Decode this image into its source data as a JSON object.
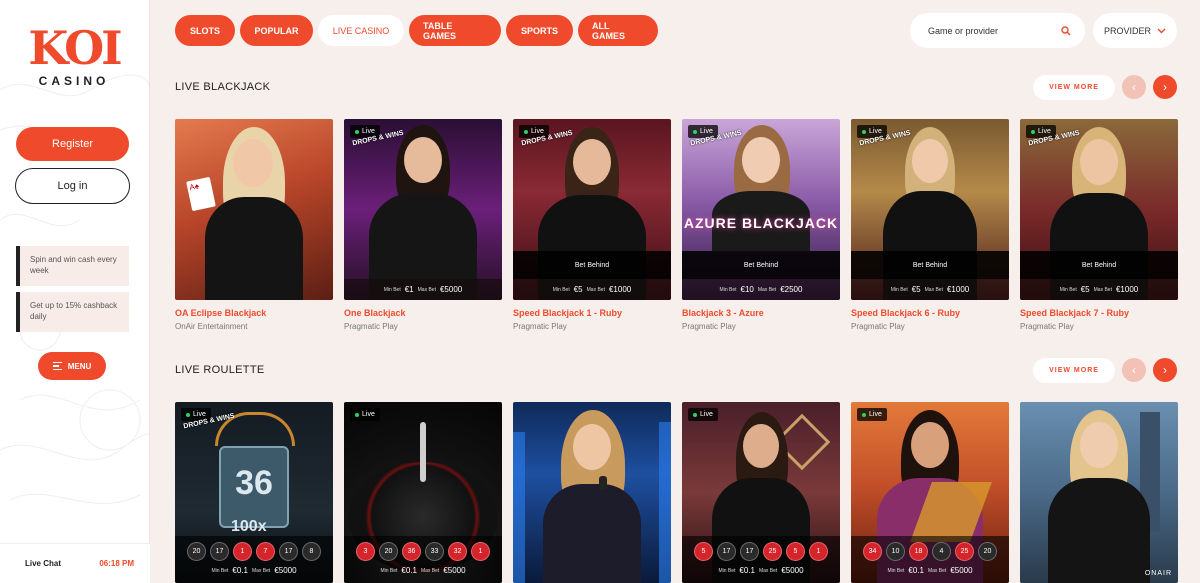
{
  "brand": {
    "logo_mark": "KOI",
    "logo_sub": "CASINO"
  },
  "sidebar": {
    "register": "Register",
    "login": "Log in",
    "promos": [
      "Spin and win cash every week",
      "Get up to 15% cashback daily"
    ],
    "menu": "MENU",
    "live_chat": "Live Chat",
    "time": "06:18 PM"
  },
  "nav": {
    "tabs": [
      "SLOTS",
      "POPULAR",
      "LIVE CASINO",
      "TABLE GAMES",
      "SPORTS",
      "ALL GAMES"
    ],
    "active_index": 2,
    "search_placeholder": "Game or provider",
    "provider": "PROVIDER"
  },
  "sections": [
    {
      "title": "LIVE BLACKJACK",
      "view_more": "VIEW MORE",
      "cards": [
        {
          "title": "OA Eclipse Blackjack",
          "provider": "OnAir Entertainment",
          "live": false,
          "bet_behind": "",
          "min_label": "",
          "min": "",
          "max_label": "",
          "max": ""
        },
        {
          "title": "One Blackjack",
          "provider": "Pragmatic Play",
          "live": true,
          "bet_behind": "",
          "min_label": "Min Bet",
          "min": "€1",
          "max_label": "Max Bet",
          "max": "€5000"
        },
        {
          "title": "Speed Blackjack 1 - Ruby",
          "provider": "Pragmatic Play",
          "live": true,
          "bet_behind": "Bet Behind",
          "min_label": "Min Bet",
          "min": "€5",
          "max_label": "Max Bet",
          "max": "€1000"
        },
        {
          "title": "Blackjack 3 - Azure",
          "provider": "Pragmatic Play",
          "live": true,
          "bet_behind": "Bet Behind",
          "min_label": "Min Bet",
          "min": "€10",
          "max_label": "Max Bet",
          "max": "€2500"
        },
        {
          "title": "Speed Blackjack 6 - Ruby",
          "provider": "Pragmatic Play",
          "live": true,
          "bet_behind": "Bet Behind",
          "min_label": "Min Bet",
          "min": "€5",
          "max_label": "Max Bet",
          "max": "€1000"
        },
        {
          "title": "Speed Blackjack 7 - Ruby",
          "provider": "Pragmatic Play",
          "live": true,
          "bet_behind": "Bet Behind",
          "min_label": "Min Bet",
          "min": "€5",
          "max_label": "Max Bet",
          "max": "€1000"
        }
      ]
    },
    {
      "title": "LIVE ROULETTE",
      "view_more": "VIEW MORE",
      "cards": [
        {
          "live": true,
          "drops": true,
          "numbers": [
            [
              "20",
              "black"
            ],
            [
              "17",
              "black"
            ],
            [
              "1",
              "red"
            ],
            [
              "7",
              "red"
            ],
            [
              "17",
              "black"
            ],
            [
              "8",
              "black"
            ]
          ],
          "min_label": "Min Bet",
          "min": "€0.1",
          "max_label": "Max Bet",
          "max": "€5000"
        },
        {
          "live": true,
          "drops": false,
          "numbers": [
            [
              "3",
              "red"
            ],
            [
              "20",
              "black"
            ],
            [
              "36",
              "red"
            ],
            [
              "33",
              "black"
            ],
            [
              "32",
              "red"
            ],
            [
              "1",
              "red"
            ]
          ],
          "min_label": "Min Bet",
          "min": "€0.1",
          "max_label": "Max Bet",
          "max": "€5000"
        },
        {
          "live": false,
          "drops": false,
          "numbers": [],
          "min_label": "",
          "min": "",
          "max_label": "",
          "max": ""
        },
        {
          "live": true,
          "drops": false,
          "numbers": [
            [
              "5",
              "red"
            ],
            [
              "17",
              "black"
            ],
            [
              "17",
              "black"
            ],
            [
              "25",
              "red"
            ],
            [
              "5",
              "red"
            ],
            [
              "1",
              "red"
            ]
          ],
          "min_label": "Min Bet",
          "min": "€0.1",
          "max_label": "Max Bet",
          "max": "€5000"
        },
        {
          "live": true,
          "drops": false,
          "numbers": [
            [
              "34",
              "red"
            ],
            [
              "10",
              "black"
            ],
            [
              "18",
              "red"
            ],
            [
              "4",
              "black"
            ],
            [
              "25",
              "red"
            ],
            [
              "20",
              "black"
            ]
          ],
          "min_label": "Min Bet",
          "min": "€0.1",
          "max_label": "Max Bet",
          "max": "€5000"
        },
        {
          "live": false,
          "drops": false,
          "numbers": [],
          "min_label": "",
          "min": "",
          "max_label": "",
          "max": ""
        }
      ]
    }
  ],
  "drops_label": "DROPS & WINS",
  "live_label": "Live",
  "roulette_feature": "36",
  "roulette_mult": "100x",
  "onair": "ONAIR",
  "azure_text": "AZURE BLACKJACK",
  "colors": {
    "accent": "#ef4a2b",
    "bg": "#f7efec"
  }
}
